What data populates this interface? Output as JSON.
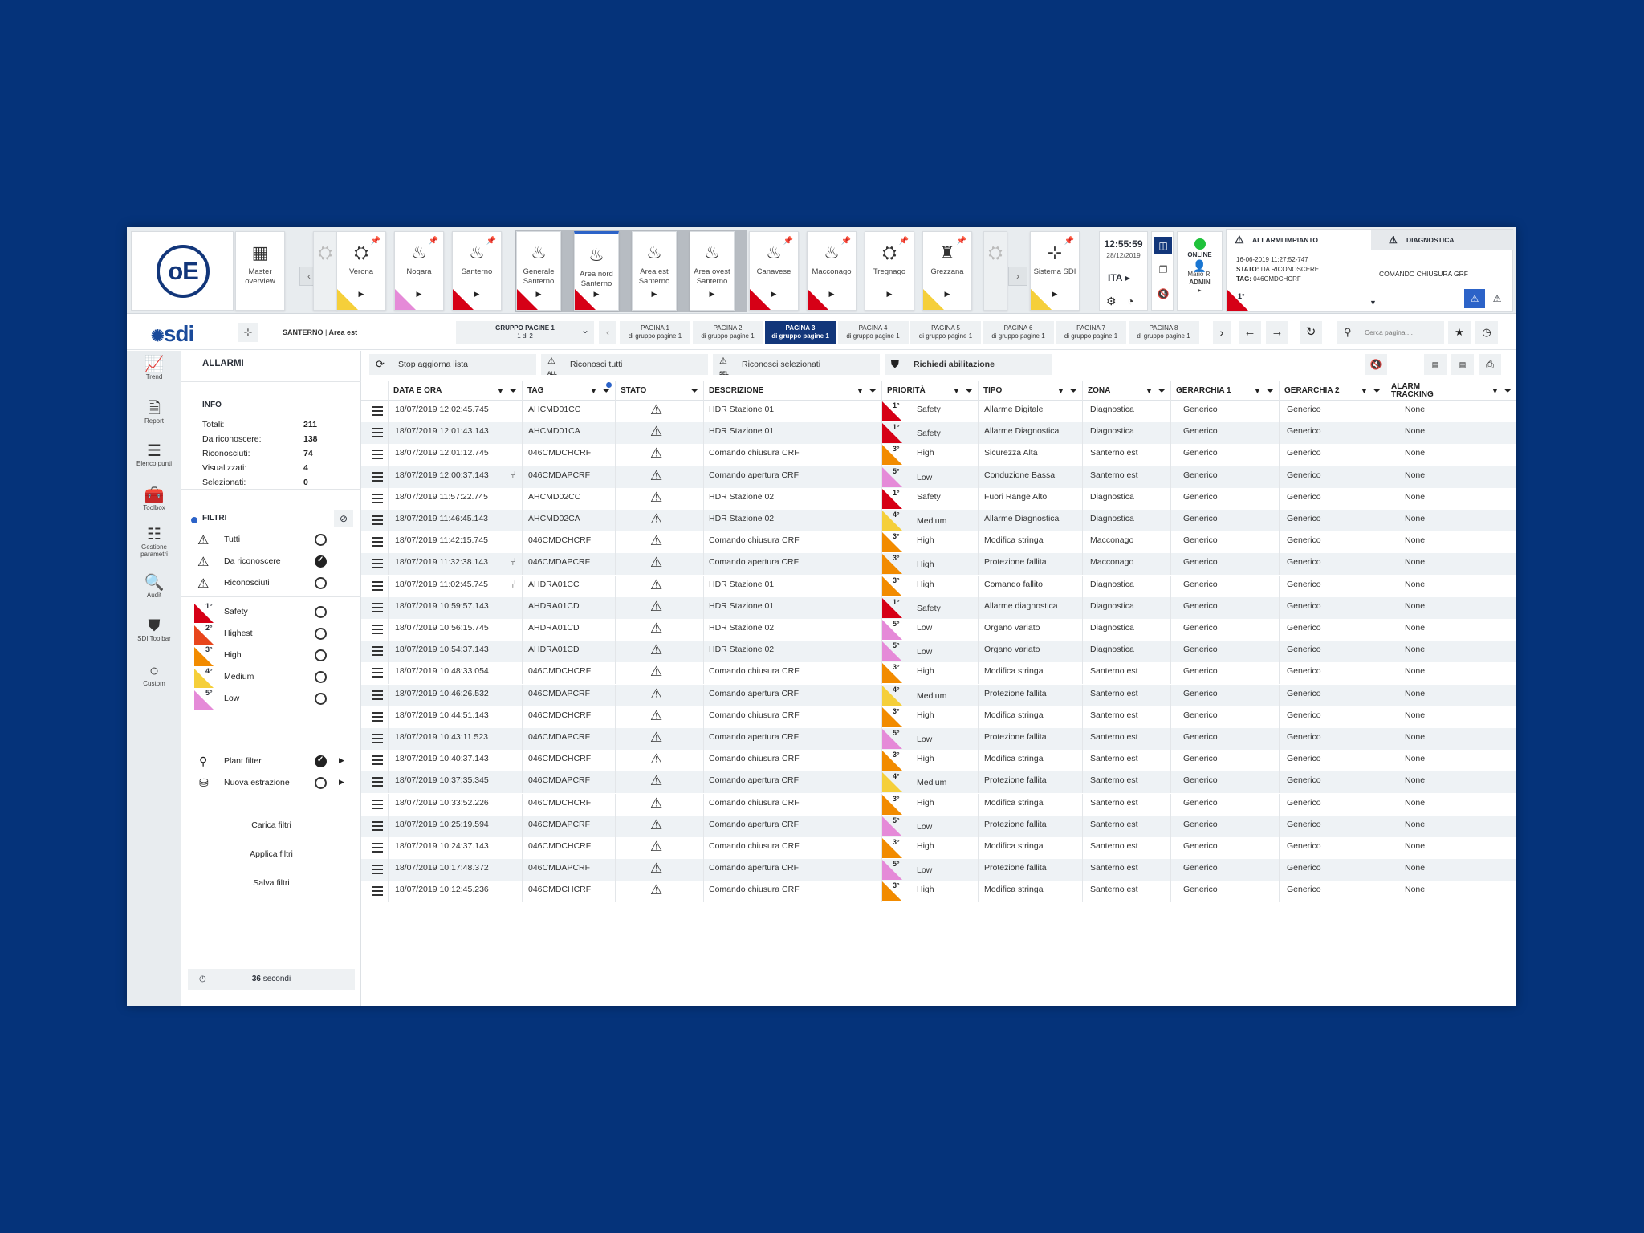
{
  "colors": {
    "bg": "#05337a",
    "accent": "#12367a",
    "safety": "#d60016",
    "highest": "#e8461c",
    "high": "#f28b00",
    "medium": "#f5cf3a",
    "low": "#e58ad8",
    "online": "#1fc23b"
  },
  "topbar": {
    "logo": "oE",
    "tiles": [
      {
        "label": "Master overview",
        "icon": "map-icon"
      },
      {
        "label": "Verona",
        "icon": "plant-icon"
      },
      {
        "label": "Nogara",
        "icon": "fire-icon"
      },
      {
        "label": "Santerno",
        "icon": "fire-icon"
      },
      {
        "label": "Generale Santerno",
        "icon": "fire-icon"
      },
      {
        "label": "Area nord Santerno",
        "icon": "fire-icon"
      },
      {
        "label": "Area est Santerno",
        "icon": "fire-icon"
      },
      {
        "label": "Area ovest Santerno",
        "icon": "fire-icon"
      },
      {
        "label": "Canavese",
        "icon": "fire-icon"
      },
      {
        "label": "Macconago",
        "icon": "fire-icon"
      },
      {
        "label": "Tregnago",
        "icon": "plant-icon"
      },
      {
        "label": "Grezzana",
        "icon": "tower-icon"
      },
      {
        "label": "Sistema SDI",
        "icon": "hierarchy-icon"
      }
    ],
    "clock": {
      "time": "12:55:59",
      "date": "28/12/2019",
      "lang": "ITA"
    },
    "status": "ONLINE",
    "user": {
      "name": "Mario R.",
      "role": "ADMIN"
    },
    "alarm_panel": {
      "tab_alarms": "ALLARMI IMPIANTO",
      "tab_diag": "DIAGNOSTICA",
      "timestamp": "16-06-2019  11:27:52-747",
      "stato_label": "STATO:",
      "stato": "DA RICONOSCERE",
      "tag_label": "TAG:",
      "tag": "046CMDCHCRF",
      "command": "COMANDO CHIUSURA GRF",
      "priority": "1°"
    }
  },
  "row2": {
    "logo": "sdi",
    "breadcrumb_plant": "SANTERNO",
    "breadcrumb_sep": "|",
    "breadcrumb_area": "Area est",
    "group": {
      "title": "GRUPPO PAGINE 1",
      "sub": "1 di 2"
    },
    "pages": [
      {
        "title": "PAGINA 1",
        "sub": "di gruppo pagine 1"
      },
      {
        "title": "PAGINA 2",
        "sub": "di gruppo pagine 1"
      },
      {
        "title": "PAGINA 3",
        "sub": "di gruppo pagine 1"
      },
      {
        "title": "PAGINA 4",
        "sub": "di gruppo pagine 1"
      },
      {
        "title": "PAGINA 5",
        "sub": "di gruppo pagine 1"
      },
      {
        "title": "PAGINA 6",
        "sub": "di gruppo pagine 1"
      },
      {
        "title": "PAGINA 7",
        "sub": "di gruppo pagine 1"
      },
      {
        "title": "PAGINA 8",
        "sub": "di gruppo pagine 1"
      }
    ],
    "search_placeholder": "Cerca pagina...."
  },
  "rail": [
    {
      "label": "Trend",
      "icon": "trend-icon"
    },
    {
      "label": "Report",
      "icon": "report-icon"
    },
    {
      "label": "Elenco punti",
      "icon": "list-icon"
    },
    {
      "label": "Toolbox",
      "icon": "toolbox-icon"
    },
    {
      "label": "Gestione parametri",
      "icon": "sliders-icon"
    },
    {
      "label": "Audit",
      "icon": "audit-icon"
    },
    {
      "label": "SDI Toolbar",
      "icon": "shield-icon"
    },
    {
      "label": "Custom",
      "icon": "circle-icon"
    }
  ],
  "panel": {
    "title": "ALLARMI",
    "info_title": "INFO",
    "info": [
      {
        "label": "Totali:",
        "value": "211"
      },
      {
        "label": "Da riconoscere:",
        "value": "138"
      },
      {
        "label": "Riconosciuti:",
        "value": "74"
      },
      {
        "label": "Visualizzati:",
        "value": "4"
      },
      {
        "label": "Selezionati:",
        "value": "0"
      }
    ],
    "filters_title": "FILTRI",
    "state_filters": [
      {
        "label": "Tutti",
        "checked": false
      },
      {
        "label": "Da riconoscere",
        "checked": true
      },
      {
        "label": "Riconosciuti",
        "checked": false
      }
    ],
    "priority_filters": [
      {
        "num": "1°",
        "label": "Safety"
      },
      {
        "num": "2°",
        "label": "Highest"
      },
      {
        "num": "3°",
        "label": "High"
      },
      {
        "num": "4°",
        "label": "Medium"
      },
      {
        "num": "5°",
        "label": "Low"
      }
    ],
    "extra": [
      {
        "label": "Plant filter",
        "checked": true
      },
      {
        "label": "Nuova estrazione",
        "checked": false
      }
    ],
    "actions": [
      "Carica filtri",
      "Applica filtri",
      "Salva filtri"
    ],
    "refresh_value": "36",
    "refresh_unit": "secondi"
  },
  "toolbar": {
    "stop": "Stop aggiorna lista",
    "ack_all": "Riconosci tutti",
    "ack_sel": "Riconosci selezionati",
    "request": "Richiedi abilitazione",
    "all_tag": "ALL",
    "sel_tag": "SEL"
  },
  "table": {
    "headers": [
      "DATA E ORA",
      "TAG",
      "STATO",
      "DESCRIZIONE",
      "PRIORITÀ",
      "TIPO",
      "ZONA",
      "GERARCHIA 1",
      "GERARCHIA 2",
      "ALARM TRACKING"
    ],
    "rows": [
      {
        "date": "18/07/2019  12:02:45.745",
        "branch": false,
        "tag": "AHCMD01CC",
        "desc": "HDR Stazione 01",
        "p": "1°",
        "plabel": "Safety",
        "tipo": "Allarme Digitale",
        "zona": "Diagnostica",
        "g1": "Generico",
        "g2": "Generico",
        "tr": "None"
      },
      {
        "date": "18/07/2019  12:01:43.143",
        "branch": false,
        "tag": "AHCMD01CA",
        "desc": "HDR Stazione 01",
        "p": "1°",
        "plabel": "Safety",
        "tipo": "Allarme Diagnostica",
        "zona": "Diagnostica",
        "g1": "Generico",
        "g2": "Generico",
        "tr": "None"
      },
      {
        "date": "18/07/2019  12:01:12.745",
        "branch": false,
        "tag": "046CMDCHCRF",
        "desc": "Comando chiusura CRF",
        "p": "3°",
        "plabel": "High",
        "tipo": "Sicurezza Alta",
        "zona": "Santerno est",
        "g1": "Generico",
        "g2": "Generico",
        "tr": "None"
      },
      {
        "date": "18/07/2019  12:00:37.143",
        "branch": true,
        "tag": "046CMDAPCRF",
        "desc": "Comando apertura CRF",
        "p": "5°",
        "plabel": "Low",
        "tipo": "Conduzione Bassa",
        "zona": "Santerno est",
        "g1": "Generico",
        "g2": "Generico",
        "tr": "None"
      },
      {
        "date": "18/07/2019  11:57:22.745",
        "branch": false,
        "tag": "AHCMD02CC",
        "desc": "HDR Stazione 02",
        "p": "1°",
        "plabel": "Safety",
        "tipo": "Fuori Range Alto",
        "zona": "Diagnostica",
        "g1": "Generico",
        "g2": "Generico",
        "tr": "None"
      },
      {
        "date": "18/07/2019  11:46:45.143",
        "branch": false,
        "tag": "AHCMD02CA",
        "desc": "HDR Stazione 02",
        "p": "4°",
        "plabel": "Medium",
        "tipo": "Allarme Diagnostica",
        "zona": "Diagnostica",
        "g1": "Generico",
        "g2": "Generico",
        "tr": "None"
      },
      {
        "date": "18/07/2019  11:42:15.745",
        "branch": false,
        "tag": "046CMDCHCRF",
        "desc": "Comando chiusura CRF",
        "p": "3°",
        "plabel": "High",
        "tipo": "Modifica stringa",
        "zona": "Macconago",
        "g1": "Generico",
        "g2": "Generico",
        "tr": "None"
      },
      {
        "date": "18/07/2019  11:32:38.143",
        "branch": true,
        "tag": "046CMDAPCRF",
        "desc": "Comando apertura CRF",
        "p": "3°",
        "plabel": "High",
        "tipo": "Protezione fallita",
        "zona": "Macconago",
        "g1": "Generico",
        "g2": "Generico",
        "tr": "None"
      },
      {
        "date": "18/07/2019  11:02:45.745",
        "branch": true,
        "tag": "AHDRA01CC",
        "desc": "HDR Stazione 01",
        "p": "3°",
        "plabel": "High",
        "tipo": "Comando fallito",
        "zona": "Diagnostica",
        "g1": "Generico",
        "g2": "Generico",
        "tr": "None"
      },
      {
        "date": "18/07/2019  10:59:57.143",
        "branch": false,
        "tag": "AHDRA01CD",
        "desc": "HDR Stazione 01",
        "p": "1°",
        "plabel": "Safety",
        "tipo": "Allarme diagnostica",
        "zona": "Diagnostica",
        "g1": "Generico",
        "g2": "Generico",
        "tr": "None"
      },
      {
        "date": "18/07/2019  10:56:15.745",
        "branch": false,
        "tag": "AHDRA01CD",
        "desc": "HDR Stazione 02",
        "p": "5°",
        "plabel": "Low",
        "tipo": "Organo variato",
        "zona": "Diagnostica",
        "g1": "Generico",
        "g2": "Generico",
        "tr": "None"
      },
      {
        "date": "18/07/2019  10:54:37.143",
        "branch": false,
        "tag": "AHDRA01CD",
        "desc": "HDR Stazione 02",
        "p": "5°",
        "plabel": "Low",
        "tipo": "Organo variato",
        "zona": "Diagnostica",
        "g1": "Generico",
        "g2": "Generico",
        "tr": "None"
      },
      {
        "date": "18/07/2019  10:48:33.054",
        "branch": false,
        "tag": "046CMDCHCRF",
        "desc": "Comando chiusura CRF",
        "p": "3°",
        "plabel": "High",
        "tipo": "Modifica stringa",
        "zona": "Santerno est",
        "g1": "Generico",
        "g2": "Generico",
        "tr": "None"
      },
      {
        "date": "18/07/2019  10:46:26.532",
        "branch": false,
        "tag": "046CMDAPCRF",
        "desc": "Comando apertura CRF",
        "p": "4°",
        "plabel": "Medium",
        "tipo": "Protezione fallita",
        "zona": "Santerno est",
        "g1": "Generico",
        "g2": "Generico",
        "tr": "None"
      },
      {
        "date": "18/07/2019  10:44:51.143",
        "branch": false,
        "tag": "046CMDCHCRF",
        "desc": "Comando chiusura CRF",
        "p": "3°",
        "plabel": "High",
        "tipo": "Modifica stringa",
        "zona": "Santerno est",
        "g1": "Generico",
        "g2": "Generico",
        "tr": "None"
      },
      {
        "date": "18/07/2019  10:43:11.523",
        "branch": false,
        "tag": "046CMDAPCRF",
        "desc": "Comando apertura CRF",
        "p": "5°",
        "plabel": "Low",
        "tipo": "Protezione fallita",
        "zona": "Santerno est",
        "g1": "Generico",
        "g2": "Generico",
        "tr": "None"
      },
      {
        "date": "18/07/2019  10:40:37.143",
        "branch": false,
        "tag": "046CMDCHCRF",
        "desc": "Comando chiusura CRF",
        "p": "3°",
        "plabel": "High",
        "tipo": "Modifica stringa",
        "zona": "Santerno est",
        "g1": "Generico",
        "g2": "Generico",
        "tr": "None"
      },
      {
        "date": "18/07/2019  10:37:35.345",
        "branch": false,
        "tag": "046CMDAPCRF",
        "desc": "Comando apertura CRF",
        "p": "4°",
        "plabel": "Medium",
        "tipo": "Protezione fallita",
        "zona": "Santerno est",
        "g1": "Generico",
        "g2": "Generico",
        "tr": "None"
      },
      {
        "date": "18/07/2019  10:33:52.226",
        "branch": false,
        "tag": "046CMDCHCRF",
        "desc": "Comando chiusura CRF",
        "p": "3°",
        "plabel": "High",
        "tipo": "Modifica stringa",
        "zona": "Santerno est",
        "g1": "Generico",
        "g2": "Generico",
        "tr": "None"
      },
      {
        "date": "18/07/2019  10:25:19.594",
        "branch": false,
        "tag": "046CMDAPCRF",
        "desc": "Comando apertura CRF",
        "p": "5°",
        "plabel": "Low",
        "tipo": "Protezione fallita",
        "zona": "Santerno est",
        "g1": "Generico",
        "g2": "Generico",
        "tr": "None"
      },
      {
        "date": "18/07/2019  10:24:37.143",
        "branch": false,
        "tag": "046CMDCHCRF",
        "desc": "Comando chiusura CRF",
        "p": "3°",
        "plabel": "High",
        "tipo": "Modifica stringa",
        "zona": "Santerno est",
        "g1": "Generico",
        "g2": "Generico",
        "tr": "None"
      },
      {
        "date": "18/07/2019  10:17:48.372",
        "branch": false,
        "tag": "046CMDAPCRF",
        "desc": "Comando apertura CRF",
        "p": "5°",
        "plabel": "Low",
        "tipo": "Protezione fallita",
        "zona": "Santerno est",
        "g1": "Generico",
        "g2": "Generico",
        "tr": "None"
      },
      {
        "date": "18/07/2019  10:12:45.236",
        "branch": false,
        "tag": "046CMDCHCRF",
        "desc": "Comando chiusura CRF",
        "p": "3°",
        "plabel": "High",
        "tipo": "Modifica stringa",
        "zona": "Santerno est",
        "g1": "Generico",
        "g2": "Generico",
        "tr": "None"
      }
    ]
  }
}
